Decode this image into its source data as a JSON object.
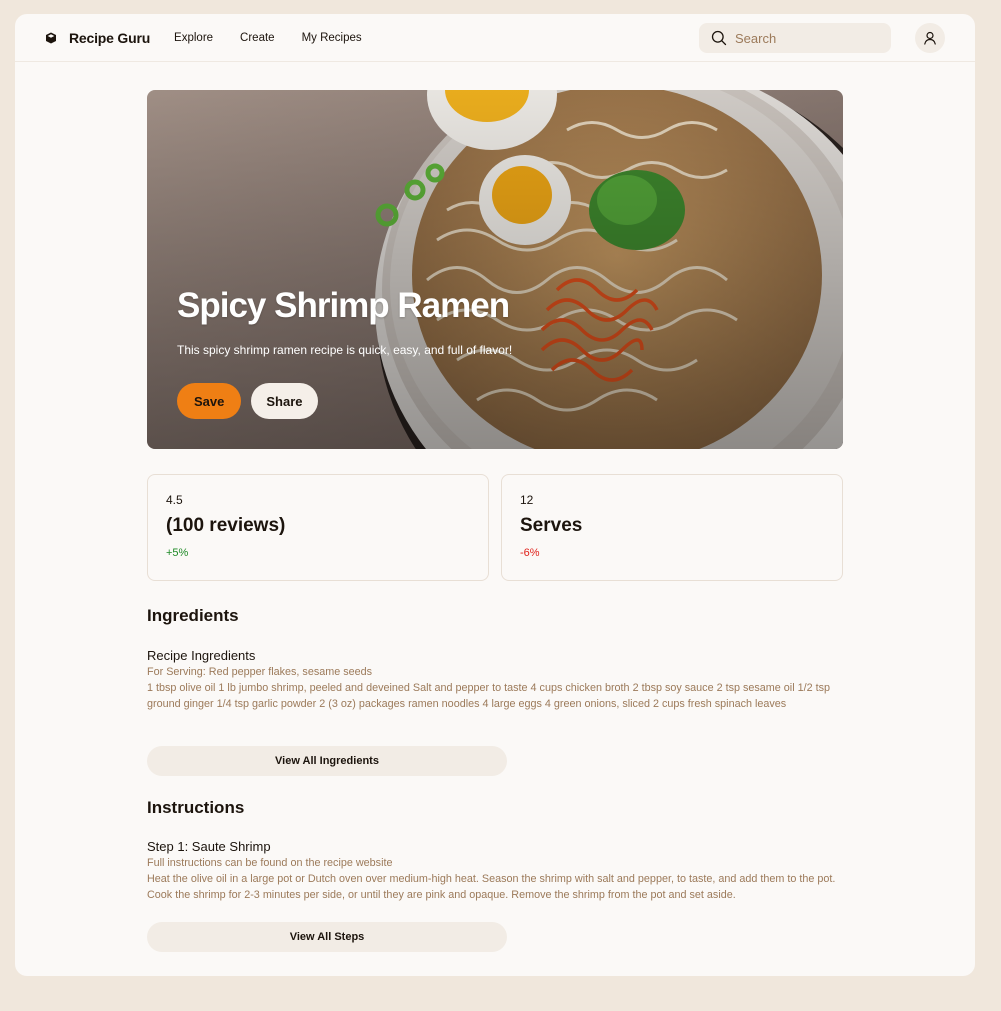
{
  "app": {
    "name": "Recipe Guru"
  },
  "nav": {
    "items": [
      "Explore",
      "Create",
      "My Recipes"
    ]
  },
  "search": {
    "placeholder": "Search"
  },
  "hero": {
    "title": "Spicy Shrimp Ramen",
    "subtitle": "This spicy shrimp ramen recipe is quick, easy, and full of flavor!",
    "save_label": "Save",
    "share_label": "Share"
  },
  "stats": [
    {
      "value": "4.5",
      "label": "(100 reviews)",
      "change": "+5%",
      "trend": "up"
    },
    {
      "value": "12",
      "label": "Serves",
      "change": "-6%",
      "trend": "down"
    }
  ],
  "ingredients": {
    "heading": "Ingredients",
    "subheading": "Recipe Ingredients",
    "serving": "For Serving: Red pepper flakes, sesame seeds",
    "list": "1 tbsp olive oil 1 lb jumbo shrimp, peeled and deveined Salt and pepper to taste 4 cups chicken broth 2 tbsp soy sauce 2 tsp sesame oil 1/2 tsp ground ginger 1/4 tsp garlic powder 2 (3 oz) packages ramen noodles 4 large eggs 4 green onions, sliced 2 cups fresh spinach leaves",
    "button": "View All Ingredients"
  },
  "instructions": {
    "heading": "Instructions",
    "step_title": "Step 1: Saute Shrimp",
    "note": "Full instructions can be found on the recipe website",
    "text": "Heat the olive oil in a large pot or Dutch oven over medium-high heat. Season the shrimp with salt and pepper, to taste, and add them to the pot. Cook the shrimp for 2-3 minutes per side, or until they are pink and opaque. Remove the shrimp from the pot and set aside.",
    "button": "View All Steps"
  },
  "colors": {
    "accent": "#ef7f14",
    "muted_text": "#9c7a5a",
    "positive": "#1e8a26",
    "negative": "#e0221b",
    "page_bg": "#f0e7dc"
  },
  "icons": {
    "logo": "cube-icon",
    "search": "search-icon",
    "profile": "user-icon"
  }
}
